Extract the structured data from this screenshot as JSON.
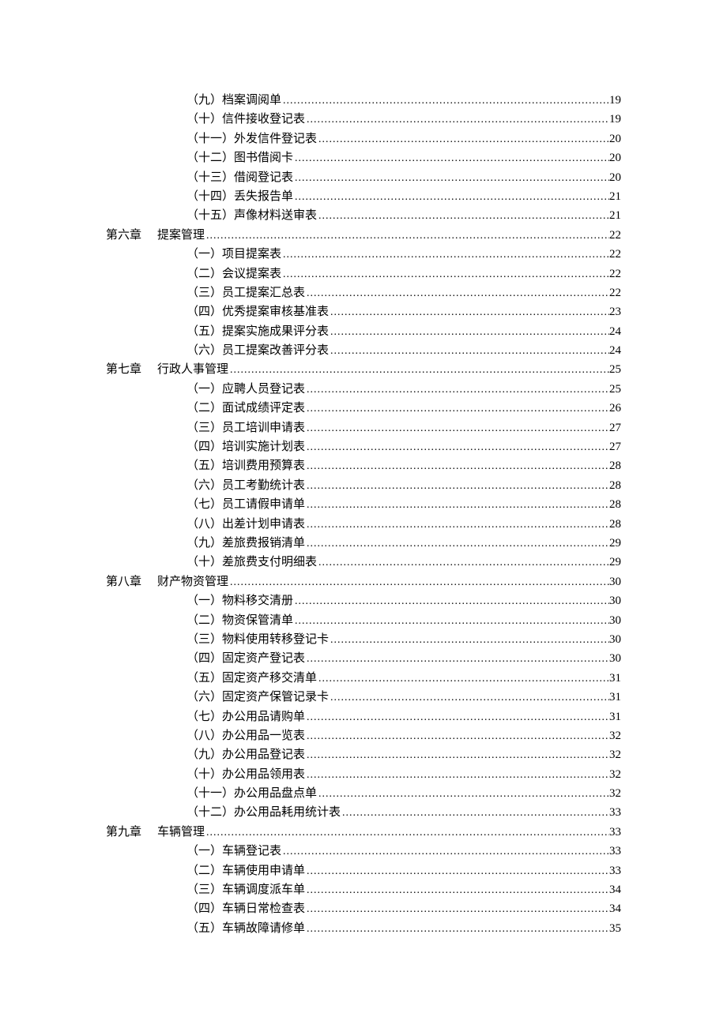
{
  "toc": [
    {
      "type": "sub",
      "label": "（九）档案调阅单",
      "page": "19"
    },
    {
      "type": "sub",
      "label": "（十）信件接收登记表",
      "page": "19"
    },
    {
      "type": "sub",
      "label": "（十一）外发信件登记表",
      "page": "20"
    },
    {
      "type": "sub",
      "label": "（十二）图书借阅卡",
      "page": "20"
    },
    {
      "type": "sub",
      "label": "（十三）借阅登记表",
      "page": "20"
    },
    {
      "type": "sub",
      "label": "（十四）丢失报告单",
      "page": "21"
    },
    {
      "type": "sub",
      "label": "（十五）声像材料送审表",
      "page": "21"
    },
    {
      "type": "chapter",
      "num": "第六章",
      "title": "提案管理",
      "page": "22"
    },
    {
      "type": "sub",
      "label": "（一）项目提案表",
      "page": "22"
    },
    {
      "type": "sub",
      "label": "（二）会议提案表",
      "page": "22"
    },
    {
      "type": "sub",
      "label": "（三）员工提案汇总表",
      "page": "22"
    },
    {
      "type": "sub",
      "label": "（四）优秀提案审核基准表",
      "page": "23"
    },
    {
      "type": "sub",
      "label": "（五）提案实施成果评分表",
      "page": "24"
    },
    {
      "type": "sub",
      "label": "（六）员工提案改善评分表",
      "page": "24"
    },
    {
      "type": "chapter",
      "num": "第七章",
      "title": "行政人事管理",
      "page": "25"
    },
    {
      "type": "sub",
      "label": "（一）应聘人员登记表",
      "page": "25"
    },
    {
      "type": "sub",
      "label": "（二）面试成绩评定表",
      "page": "26"
    },
    {
      "type": "sub",
      "label": "（三）员工培训申请表",
      "page": "27"
    },
    {
      "type": "sub",
      "label": "（四）培训实施计划表",
      "page": "27"
    },
    {
      "type": "sub",
      "label": "（五）培训费用预算表",
      "page": "28"
    },
    {
      "type": "sub",
      "label": "（六）员工考勤统计表",
      "page": "28"
    },
    {
      "type": "sub",
      "label": "（七）员工请假申请单",
      "page": "28"
    },
    {
      "type": "sub",
      "label": "（八）出差计划申请表",
      "page": "28"
    },
    {
      "type": "sub",
      "label": "（九）差旅费报销清单",
      "page": "29"
    },
    {
      "type": "sub",
      "label": "（十）差旅费支付明细表",
      "page": "29"
    },
    {
      "type": "chapter",
      "num": "第八章",
      "title": "财产物资管理",
      "page": "30"
    },
    {
      "type": "sub",
      "label": "（一）物料移交清册",
      "page": "30"
    },
    {
      "type": "sub",
      "label": "（二）物资保管清单",
      "page": "30"
    },
    {
      "type": "sub",
      "label": "（三）物料使用转移登记卡",
      "page": "30"
    },
    {
      "type": "sub",
      "label": "（四）固定资产登记表",
      "page": "30"
    },
    {
      "type": "sub",
      "label": "（五）固定资产移交清单",
      "page": "31"
    },
    {
      "type": "sub",
      "label": "（六）固定资产保管记录卡",
      "page": "31"
    },
    {
      "type": "sub",
      "label": "（七）办公用品请购单",
      "page": "31"
    },
    {
      "type": "sub",
      "label": "（八）办公用品一览表",
      "page": "32"
    },
    {
      "type": "sub",
      "label": "（九）办公用品登记表",
      "page": "32"
    },
    {
      "type": "sub",
      "label": "（十）办公用品领用表",
      "page": "32"
    },
    {
      "type": "sub",
      "label": "（十一）办公用品盘点单",
      "page": "32"
    },
    {
      "type": "sub",
      "label": "（十二）办公用品耗用统计表",
      "page": "33"
    },
    {
      "type": "chapter",
      "num": "第九章",
      "title": "车辆管理",
      "page": "33"
    },
    {
      "type": "sub",
      "label": "（一）车辆登记表",
      "page": "33"
    },
    {
      "type": "sub",
      "label": "（二）车辆使用申请单",
      "page": "33"
    },
    {
      "type": "sub",
      "label": "（三）车辆调度派车单",
      "page": "34"
    },
    {
      "type": "sub",
      "label": "（四）车辆日常检查表",
      "page": "34"
    },
    {
      "type": "sub",
      "label": "（五）车辆故障请修单",
      "page": "35"
    }
  ]
}
